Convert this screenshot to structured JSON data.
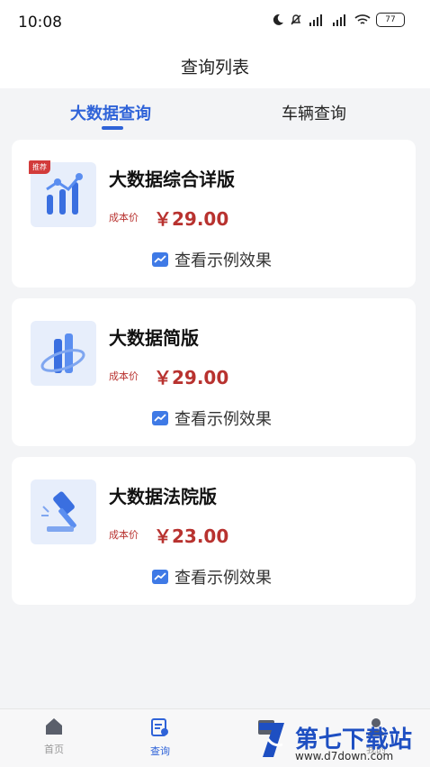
{
  "status_bar": {
    "time": "10:08",
    "battery": "77"
  },
  "header": {
    "title": "查询列表"
  },
  "tabs": [
    {
      "label": "大数据查询"
    },
    {
      "label": "车辆查询"
    }
  ],
  "cards": [
    {
      "badge": "推荐",
      "title": "大数据综合详版",
      "cost_label": "成本价",
      "price": "￥29.00",
      "example_label": "查看示例效果"
    },
    {
      "title": "大数据简版",
      "cost_label": "成本价",
      "price": "￥29.00",
      "example_label": "查看示例效果"
    },
    {
      "title": "大数据法院版",
      "cost_label": "成本价",
      "price": "￥23.00",
      "example_label": "查看示例效果"
    }
  ],
  "bottom_nav": [
    {
      "label": "首页"
    },
    {
      "label": "查询"
    },
    {
      "label": ""
    },
    {
      "label": "我的"
    }
  ],
  "watermark": {
    "brand": "第七下载站",
    "url": "www.d7down.com"
  }
}
